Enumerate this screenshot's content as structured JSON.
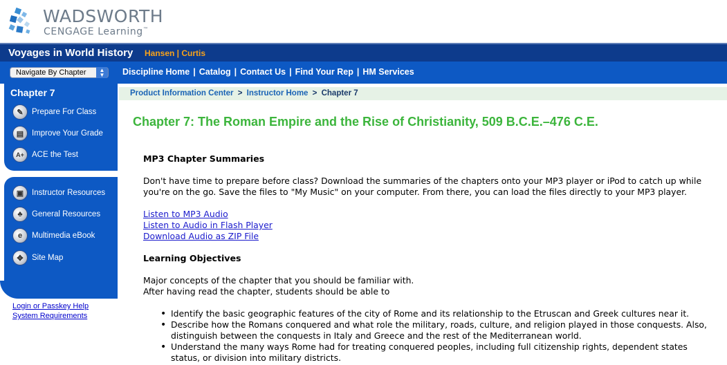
{
  "brand": {
    "line1": "WADSWORTH",
    "line2": "CENGAGE Learning",
    "trademark": "™"
  },
  "header": {
    "title": "Voyages in World History",
    "authors": "Hansen | Curtis"
  },
  "nav": {
    "select_value": "Navigate By Chapter",
    "links": [
      "Discipline Home",
      "Catalog",
      "Contact Us",
      "Find Your Rep",
      "HM Services"
    ]
  },
  "sidebar": {
    "chapter": "Chapter 7",
    "group1": [
      {
        "label": "Prepare For Class",
        "icon": "pencil-icon"
      },
      {
        "label": "Improve Your Grade",
        "icon": "book-icon"
      },
      {
        "label": "ACE the Test",
        "icon": "aplus-icon"
      }
    ],
    "group2": [
      {
        "label": "Instructor Resources",
        "icon": "lock-icon"
      },
      {
        "label": "General Resources",
        "icon": "shapes-icon"
      },
      {
        "label": "Multimedia eBook",
        "icon": "ebook-icon"
      },
      {
        "label": "Site Map",
        "icon": "sitemap-icon"
      }
    ],
    "bottom_links": [
      "Login or Passkey Help",
      "System Requirements"
    ]
  },
  "breadcrumb": {
    "items": [
      "Product Information Center",
      "Instructor Home"
    ],
    "current": "Chapter 7",
    "separator": ">"
  },
  "page": {
    "title": "Chapter 7: The Roman Empire and the Rise of Christianity, 509 B.C.E.–476 C.E.",
    "mp3": {
      "heading": "MP3 Chapter Summaries",
      "text_line1": "Don't have time to prepare before class? Download the summaries of the chapters onto your MP3 player or iPod to catch up while",
      "text_line2": "you're on the go. Save the files to \"My Music\" on your computer. From there, you can load the files directly to your MP3 player.",
      "links": [
        "Listen to MP3 Audio",
        "Listen to Audio in Flash Player",
        "Download Audio as ZIP File"
      ]
    },
    "objectives": {
      "heading": "Learning Objectives",
      "intro1": "Major concepts of the chapter that you should be familiar with.",
      "intro2": "After having read the chapter, students should be able to",
      "bullets": [
        [
          "Identify the basic geographic features of the city of Rome and its relationship to the Etruscan and Greek cultures near it."
        ],
        [
          "Describe how the Romans conquered and what role the military, roads, culture, and religion played in those conquests. Also,",
          "distinguish between the conquests in Italy and Greece and the rest of the Mediterranean world."
        ],
        [
          "Understand the many ways Rome had for treating conquered peoples, including full citizenship rights, dependent states",
          "status, or division into military districts."
        ]
      ]
    }
  },
  "colors": {
    "dark_blue": "#0d3b8c",
    "nav_blue": "#0d59c4",
    "orange": "#f7a21b",
    "title_green": "#3cb53c",
    "breadcrumb_bg": "#e6f2e6"
  }
}
